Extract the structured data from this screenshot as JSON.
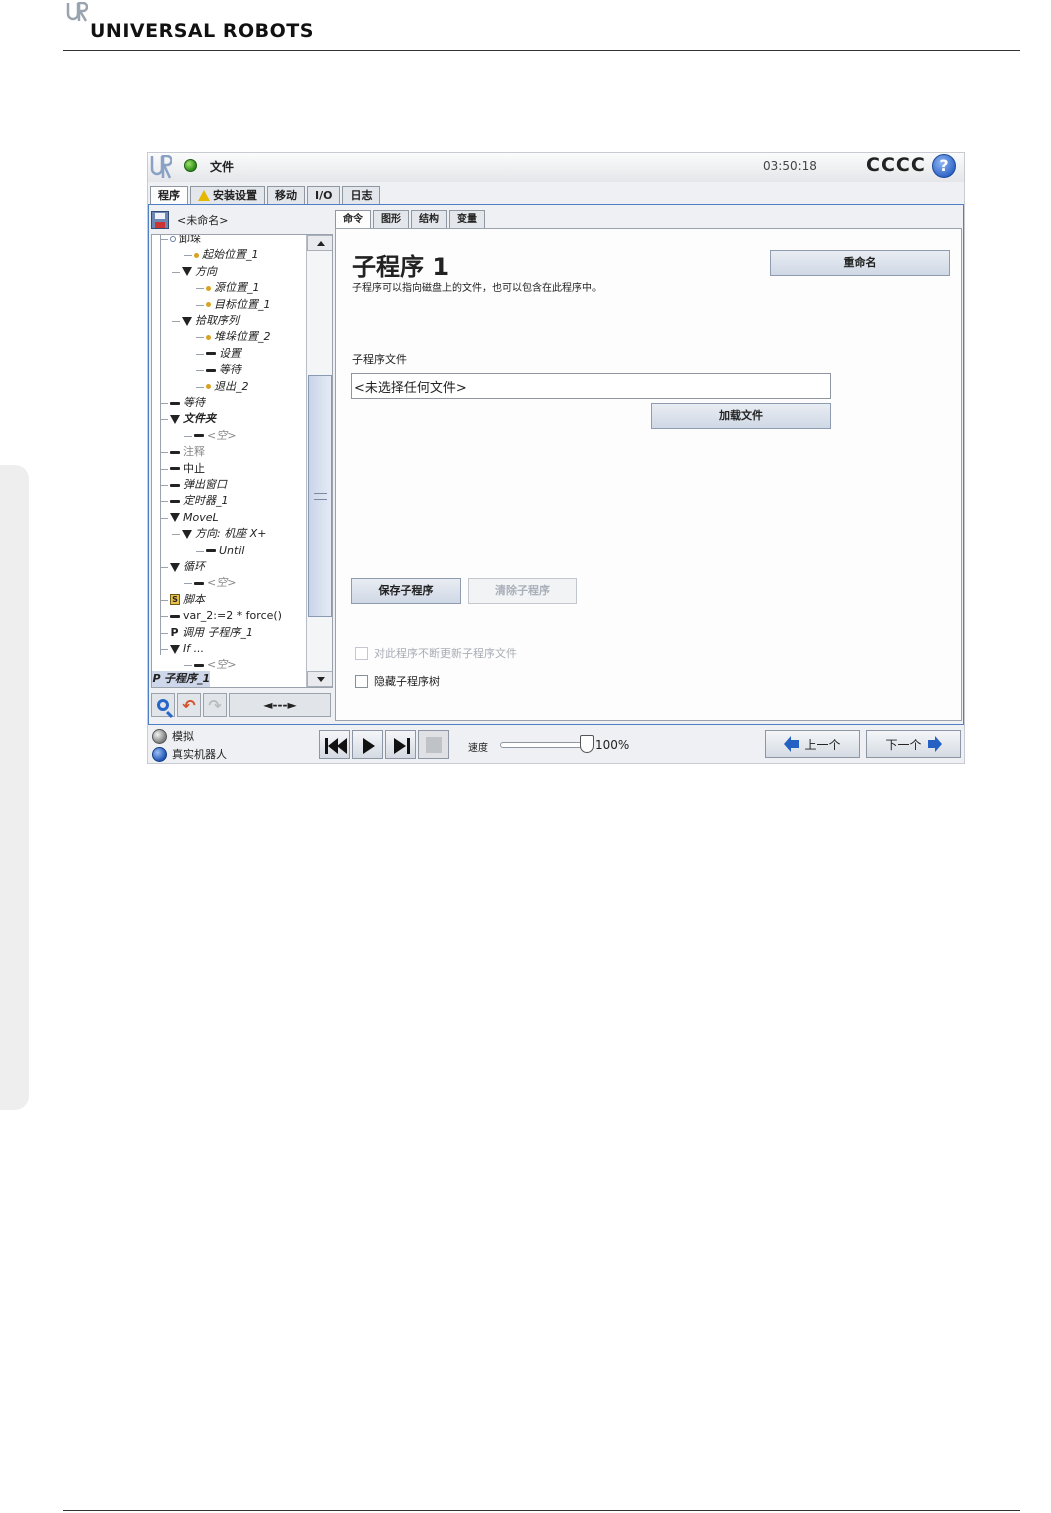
{
  "page": {
    "brand_name": "UNIVERSAL ROBOTS"
  },
  "titlebar": {
    "file_menu": "文件",
    "clock": "03:50:18",
    "robot_name": "CCCC",
    "help_glyph": "?"
  },
  "main_tabs": [
    "程序",
    "安装设置",
    "移动",
    "I/O",
    "日志"
  ],
  "tree": {
    "program_name": "<未命名>",
    "rows": [
      {
        "label": "卸垛",
        "indent": 0,
        "icon": "pin",
        "italic": false
      },
      {
        "label": "起始位置_1",
        "indent": 2,
        "icon": "dot",
        "italic": true
      },
      {
        "label": "方向",
        "indent": 1,
        "icon": "tri",
        "italic": true
      },
      {
        "label": "源位置_1",
        "indent": 3,
        "icon": "dot",
        "italic": true
      },
      {
        "label": "目标位置_1",
        "indent": 3,
        "icon": "dot",
        "italic": true
      },
      {
        "label": "拾取序列",
        "indent": 1,
        "icon": "tri",
        "italic": true
      },
      {
        "label": "堆垛位置_2",
        "indent": 3,
        "icon": "dot",
        "italic": true
      },
      {
        "label": "设置",
        "indent": 3,
        "icon": "bar",
        "italic": true
      },
      {
        "label": "等待",
        "indent": 3,
        "icon": "bar",
        "italic": true
      },
      {
        "label": "退出_2",
        "indent": 3,
        "icon": "dot",
        "italic": true
      },
      {
        "label": "等待",
        "indent": 0,
        "icon": "bar",
        "italic": true
      },
      {
        "label": "文件夹",
        "indent": 0,
        "icon": "tri",
        "italic": true,
        "bold": true
      },
      {
        "label": "<空>",
        "indent": 2,
        "icon": "bar",
        "italic": true,
        "gray": true
      },
      {
        "label": "注释",
        "indent": 0,
        "icon": "bar",
        "italic": false,
        "gray": true
      },
      {
        "label": "中止",
        "indent": 0,
        "icon": "bar",
        "italic": false
      },
      {
        "label": "弹出窗口",
        "indent": 0,
        "icon": "bar",
        "italic": true
      },
      {
        "label": "定时器_1",
        "indent": 0,
        "icon": "bar",
        "italic": true
      },
      {
        "label": "MoveL",
        "indent": 0,
        "icon": "tri",
        "italic": true
      },
      {
        "label": "方向: 机座 X+",
        "indent": 1,
        "icon": "tri",
        "italic": true
      },
      {
        "label": "Until",
        "indent": 3,
        "icon": "bar",
        "italic": true
      },
      {
        "label": "循环",
        "indent": 0,
        "icon": "tri",
        "italic": true
      },
      {
        "label": "<空>",
        "indent": 2,
        "icon": "bar",
        "italic": true,
        "gray": true
      },
      {
        "label": "脚本",
        "indent": 0,
        "icon": "script",
        "italic": true
      },
      {
        "label": "var_2:=2 * force()",
        "indent": 0,
        "icon": "bar",
        "italic": false
      },
      {
        "label": "调用 子程序_1",
        "indent": 0,
        "icon": "p",
        "italic": true
      },
      {
        "label": "If ...",
        "indent": 0,
        "icon": "tri",
        "italic": true
      },
      {
        "label": "<空>",
        "indent": 2,
        "icon": "bar",
        "italic": true,
        "gray": true
      }
    ],
    "selected_label": "子程序_1",
    "move_label": "◄---►"
  },
  "cmd_tabs": [
    "命令",
    "图形",
    "结构",
    "变量"
  ],
  "panel": {
    "title": "子程序 1",
    "description": "子程序可以指向磁盘上的文件，也可以包含在此程序中。",
    "rename_button": "重命名",
    "file_label": "子程序文件",
    "file_value": "<未选择任何文件>",
    "load_button": "加载文件",
    "save_button": "保存子程序",
    "clear_button": "清除子程序",
    "no_update_label": "对此程序不断更新子程序文件",
    "hide_tree_label": "隐藏子程序树"
  },
  "footer": {
    "simulation_label": "模拟",
    "real_robot_label": "真实机器人",
    "speed_label": "速度",
    "speed_value": "100%",
    "prev_button": "上一个",
    "next_button": "下一个"
  },
  "colors": {
    "accent": "#4f7fc4",
    "status_green": "#2b8a17",
    "warning": "#e5b800"
  }
}
